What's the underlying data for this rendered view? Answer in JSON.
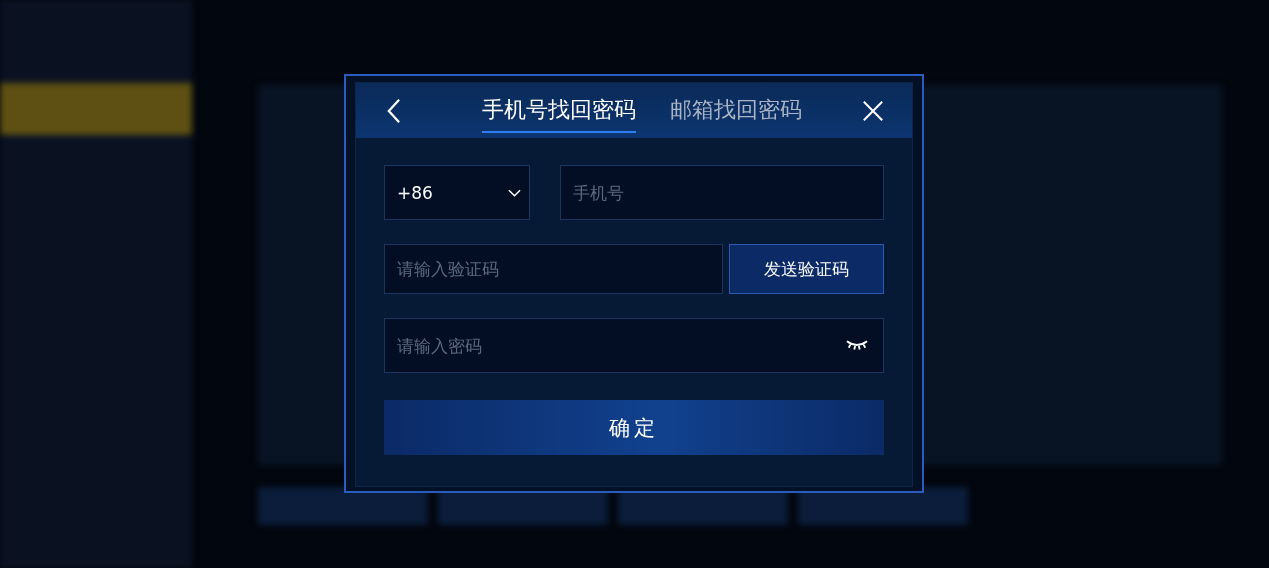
{
  "dialog": {
    "tabs": [
      {
        "label": "手机号找回密码",
        "selected": true
      },
      {
        "label": "邮箱找回密码",
        "selected": false
      }
    ],
    "country_code": "+86",
    "phone": {
      "placeholder": "手机号"
    },
    "code": {
      "placeholder": "请输入验证码"
    },
    "send_button": "发送验证码",
    "password": {
      "placeholder": "请输入密码",
      "visible": false
    },
    "confirm_button": "确定"
  }
}
